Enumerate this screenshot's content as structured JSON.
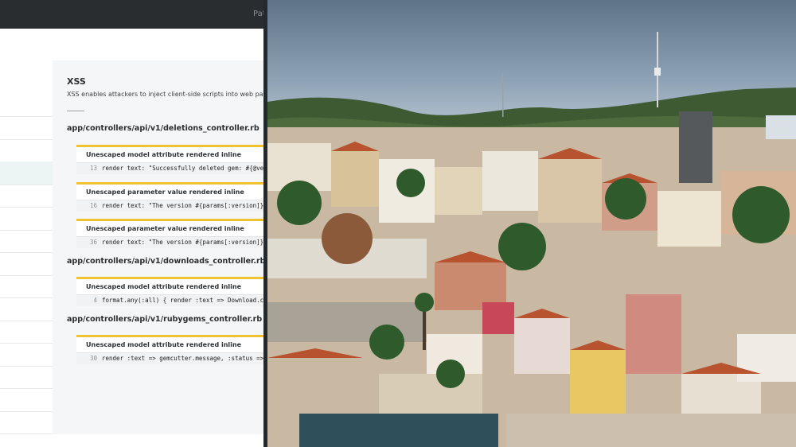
{
  "topbar": {
    "paths_label": "Path"
  },
  "sidebar": {
    "row_count": 15,
    "active_index": 3
  },
  "xss": {
    "title": "XSS",
    "description": "XSS enables attackers to inject client-side scripts into web pages"
  },
  "files": [
    {
      "path": "app/controllers/api/v1/deletions_controller.rb",
      "issues": [
        {
          "title": "Unescaped model attribute rendered inline",
          "line": "13",
          "code": "render text: \"Successfully deleted gem: #{@version.to_title}\""
        },
        {
          "title": "Unescaped parameter value rendered inline",
          "line": "16",
          "code": "render text: \"The version #{params[:version]} does not exist\""
        },
        {
          "title": "Unescaped parameter value rendered inline",
          "line": "36",
          "code": "render text: \"The version #{params[:version]} is already deleted\""
        }
      ]
    },
    {
      "path": "app/controllers/api/v1/downloads_controller.rb",
      "issues": [
        {
          "title": "Unescaped model attribute rendered inline",
          "line": "4",
          "code": "format.any(:all) { render :text => Download.count }"
        }
      ]
    },
    {
      "path": "app/controllers/api/v1/rubygems_controller.rb",
      "issues": [
        {
          "title": "Unescaped model attribute rendered inline",
          "line": "30",
          "code": "render :text => gemcutter.message, :status => gemcutter.code"
        }
      ]
    }
  ],
  "colors": {
    "topbar": "#2a2d2f",
    "issue_accent": "#f1c232",
    "content_bg": "#f4f6f7",
    "sidebar_active": "#ecf5f3",
    "divider": "#23292d",
    "sky": "#8fa7bf",
    "hills": "#3d5a33"
  },
  "photo": {
    "subject": "city-hillside-photo"
  }
}
